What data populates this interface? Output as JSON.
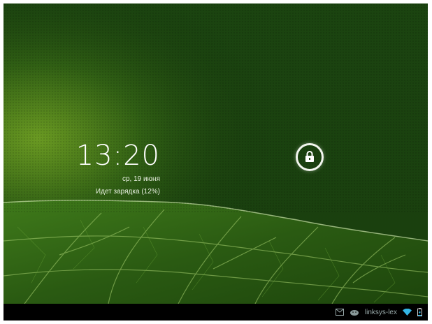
{
  "lockscreen": {
    "time": "13:20",
    "date": "ср, 19 июня",
    "charging_status": "Идет зарядка (12%)",
    "battery_level_percent": 12,
    "unlock_icon": "lock-icon"
  },
  "status_bar": {
    "wifi_network": "linksys-lex",
    "icons": [
      "gmail-icon",
      "android-icon",
      "wifi-icon",
      "battery-charging-icon"
    ]
  },
  "colors": {
    "wallpaper_dark": "#173a0c",
    "wallpaper_light": "#5a8a1e",
    "navbar": "#000000",
    "text": "#ffffff"
  }
}
